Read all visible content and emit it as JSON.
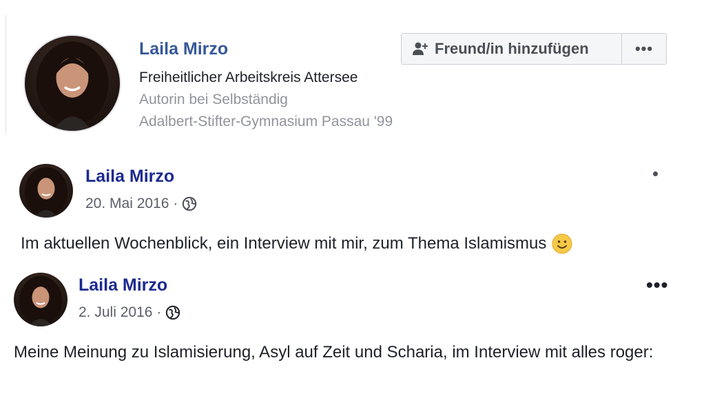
{
  "profile_card": {
    "name": "Laila Mirzo",
    "line1": "Freiheitlicher Arbeitskreis Attersee",
    "line2": "Autorin bei Selbständig",
    "line3": "Adalbert-Stifter-Gymnasium Passau '99",
    "add_friend_label": "Freund/in hinzufügen",
    "more_label": "•••"
  },
  "posts": [
    {
      "author": "Laila Mirzo",
      "date": "20. Mai 2016",
      "separator": "·",
      "text": "Im aktuellen Wochenblick, ein Interview mit mir, zum Thema Islamismus",
      "audience_icon": "globe-icon",
      "emoji": "smiley"
    },
    {
      "author": "Laila Mirzo",
      "date": "2. Juli 2016",
      "separator": "·",
      "more_label": "•••",
      "text": "Meine Meinung zu Islamisierung, Asyl auf Zeit und Scharia, im Interview mit alles roger:",
      "audience_icon": "globe-icon"
    }
  ],
  "colors": {
    "name_link": "#365899",
    "post_author": "#1c2a8f",
    "muted_text": "#90949c",
    "button_bg": "#f5f6f7"
  }
}
